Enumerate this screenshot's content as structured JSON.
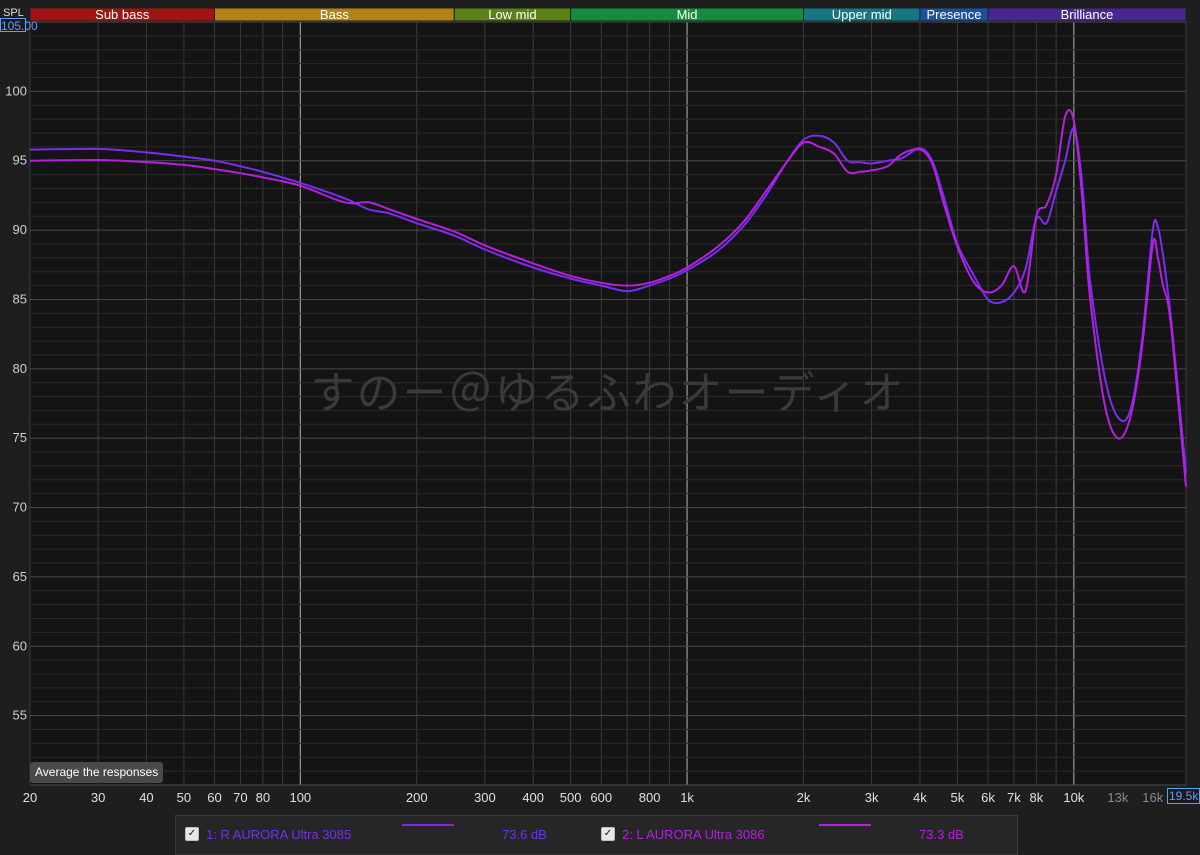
{
  "colors": {
    "background": "#1e1e1e",
    "plot_bg": "#141414",
    "series1": "#7a2cf0",
    "series2": "#b81ee0",
    "accent": "#5aa0ff"
  },
  "bands": [
    {
      "label": "Sub bass",
      "from": 20,
      "to": 60,
      "color": "#a01414"
    },
    {
      "label": "Bass",
      "from": 60,
      "to": 250,
      "color": "#b38214"
    },
    {
      "label": "Low mid",
      "from": 250,
      "to": 500,
      "color": "#5a8214"
    },
    {
      "label": "Mid",
      "from": 500,
      "to": 2000,
      "color": "#148c3c"
    },
    {
      "label": "Upper mid",
      "from": 2000,
      "to": 4000,
      "color": "#147882"
    },
    {
      "label": "Presence",
      "from": 4000,
      "to": 6000,
      "color": "#1e50a0"
    },
    {
      "label": "Brilliance",
      "from": 6000,
      "to": 20000,
      "color": "#4a2690"
    }
  ],
  "axis_top": {
    "unit_label": "SPL",
    "value_box": "105.00"
  },
  "watermark": "すのー＠ゆるふわオーディオ",
  "freq_box": "19.5k",
  "average_button": "Average the responses",
  "legend": [
    {
      "index_label": "1: R AURORA Ultra 3085",
      "db": "73.6 dB",
      "color": "#7a2cf0",
      "checked": "✓"
    },
    {
      "index_label": "2: L AURORA Ultra 3086",
      "db": "73.3 dB",
      "color": "#b81ee0",
      "checked": "✓"
    }
  ],
  "chart_data": {
    "type": "line",
    "xscale": "log",
    "xlim": [
      20,
      19500
    ],
    "ylim": [
      50,
      105
    ],
    "ylabel": "SPL",
    "y_ticks": [
      55,
      60,
      65,
      70,
      75,
      80,
      85,
      90,
      95,
      100
    ],
    "x_ticks": [
      {
        "v": 20,
        "label": "20"
      },
      {
        "v": 30,
        "label": "30"
      },
      {
        "v": 40,
        "label": "40"
      },
      {
        "v": 50,
        "label": "50"
      },
      {
        "v": 60,
        "label": "60"
      },
      {
        "v": 70,
        "label": "70"
      },
      {
        "v": 80,
        "label": "80"
      },
      {
        "v": 100,
        "label": "100"
      },
      {
        "v": 200,
        "label": "200"
      },
      {
        "v": 300,
        "label": "300"
      },
      {
        "v": 400,
        "label": "400"
      },
      {
        "v": 500,
        "label": "500"
      },
      {
        "v": 600,
        "label": "600"
      },
      {
        "v": 800,
        "label": "800"
      },
      {
        "v": 1000,
        "label": "1k"
      },
      {
        "v": 2000,
        "label": "2k"
      },
      {
        "v": 3000,
        "label": "3k"
      },
      {
        "v": 4000,
        "label": "4k"
      },
      {
        "v": 5000,
        "label": "5k"
      },
      {
        "v": 6000,
        "label": "6k"
      },
      {
        "v": 7000,
        "label": "7k"
      },
      {
        "v": 8000,
        "label": "8k"
      },
      {
        "v": 10000,
        "label": "10k"
      },
      {
        "v": 13000,
        "label": "13k",
        "dim": true
      },
      {
        "v": 16000,
        "label": "16k",
        "dim": true
      }
    ],
    "series": [
      {
        "name": "1: R AURORA Ultra 3085",
        "points": [
          [
            20,
            95.8
          ],
          [
            30,
            95.85
          ],
          [
            40,
            95.6
          ],
          [
            50,
            95.3
          ],
          [
            60,
            95.0
          ],
          [
            70,
            94.6
          ],
          [
            80,
            94.2
          ],
          [
            100,
            93.4
          ],
          [
            130,
            92.3
          ],
          [
            150,
            91.5
          ],
          [
            170,
            91.2
          ],
          [
            200,
            90.5
          ],
          [
            250,
            89.6
          ],
          [
            300,
            88.6
          ],
          [
            400,
            87.3
          ],
          [
            500,
            86.5
          ],
          [
            600,
            86.0
          ],
          [
            700,
            85.6
          ],
          [
            800,
            86.0
          ],
          [
            900,
            86.5
          ],
          [
            1000,
            87.1
          ],
          [
            1200,
            88.5
          ],
          [
            1400,
            90.3
          ],
          [
            1600,
            92.5
          ],
          [
            1800,
            94.8
          ],
          [
            2000,
            96.5
          ],
          [
            2200,
            96.8
          ],
          [
            2400,
            96.3
          ],
          [
            2600,
            95.0
          ],
          [
            2800,
            94.9
          ],
          [
            3000,
            94.8
          ],
          [
            3300,
            95.0
          ],
          [
            3600,
            95.2
          ],
          [
            4000,
            95.9
          ],
          [
            4300,
            95.0
          ],
          [
            4600,
            92.5
          ],
          [
            5000,
            89.0
          ],
          [
            5500,
            86.8
          ],
          [
            6000,
            85.0
          ],
          [
            6500,
            84.8
          ],
          [
            7000,
            85.5
          ],
          [
            7500,
            87.2
          ],
          [
            8000,
            90.8
          ],
          [
            8500,
            90.5
          ],
          [
            9000,
            92.8
          ],
          [
            9500,
            95.0
          ],
          [
            10000,
            97.3
          ],
          [
            10500,
            93.5
          ],
          [
            11000,
            86.5
          ],
          [
            12000,
            79.5
          ],
          [
            13000,
            76.5
          ],
          [
            14000,
            77.0
          ],
          [
            15000,
            82.0
          ],
          [
            16000,
            90.0
          ],
          [
            16500,
            90.2
          ],
          [
            17000,
            88.2
          ],
          [
            17500,
            85.6
          ],
          [
            18000,
            82.5
          ],
          [
            19500,
            72.5
          ]
        ]
      },
      {
        "name": "2: L AURORA Ultra 3086",
        "points": [
          [
            20,
            95.0
          ],
          [
            30,
            95.05
          ],
          [
            40,
            94.9
          ],
          [
            50,
            94.7
          ],
          [
            60,
            94.4
          ],
          [
            70,
            94.1
          ],
          [
            80,
            93.8
          ],
          [
            100,
            93.2
          ],
          [
            130,
            92.0
          ],
          [
            150,
            92.0
          ],
          [
            170,
            91.5
          ],
          [
            200,
            90.8
          ],
          [
            250,
            89.9
          ],
          [
            300,
            88.9
          ],
          [
            400,
            87.6
          ],
          [
            500,
            86.7
          ],
          [
            600,
            86.2
          ],
          [
            700,
            86.0
          ],
          [
            800,
            86.2
          ],
          [
            900,
            86.7
          ],
          [
            1000,
            87.3
          ],
          [
            1200,
            88.8
          ],
          [
            1400,
            90.6
          ],
          [
            1600,
            92.8
          ],
          [
            1800,
            94.8
          ],
          [
            2000,
            96.3
          ],
          [
            2200,
            96.0
          ],
          [
            2400,
            95.5
          ],
          [
            2600,
            94.2
          ],
          [
            2800,
            94.2
          ],
          [
            3000,
            94.3
          ],
          [
            3300,
            94.6
          ],
          [
            3600,
            95.5
          ],
          [
            4000,
            95.8
          ],
          [
            4300,
            94.8
          ],
          [
            4600,
            92.0
          ],
          [
            5000,
            88.8
          ],
          [
            5500,
            86.3
          ],
          [
            6000,
            85.5
          ],
          [
            6500,
            86.0
          ],
          [
            7000,
            87.4
          ],
          [
            7500,
            85.6
          ],
          [
            8000,
            91.0
          ],
          [
            8500,
            91.8
          ],
          [
            9000,
            94.0
          ],
          [
            9500,
            98.2
          ],
          [
            10000,
            97.9
          ],
          [
            10500,
            92.5
          ],
          [
            11000,
            85.3
          ],
          [
            12000,
            77.5
          ],
          [
            13000,
            75.0
          ],
          [
            14000,
            76.5
          ],
          [
            15000,
            81.5
          ],
          [
            16000,
            89.0
          ],
          [
            16500,
            88.0
          ],
          [
            17000,
            86.0
          ],
          [
            17500,
            84.8
          ],
          [
            18000,
            82.0
          ],
          [
            19500,
            71.5
          ]
        ]
      }
    ]
  }
}
